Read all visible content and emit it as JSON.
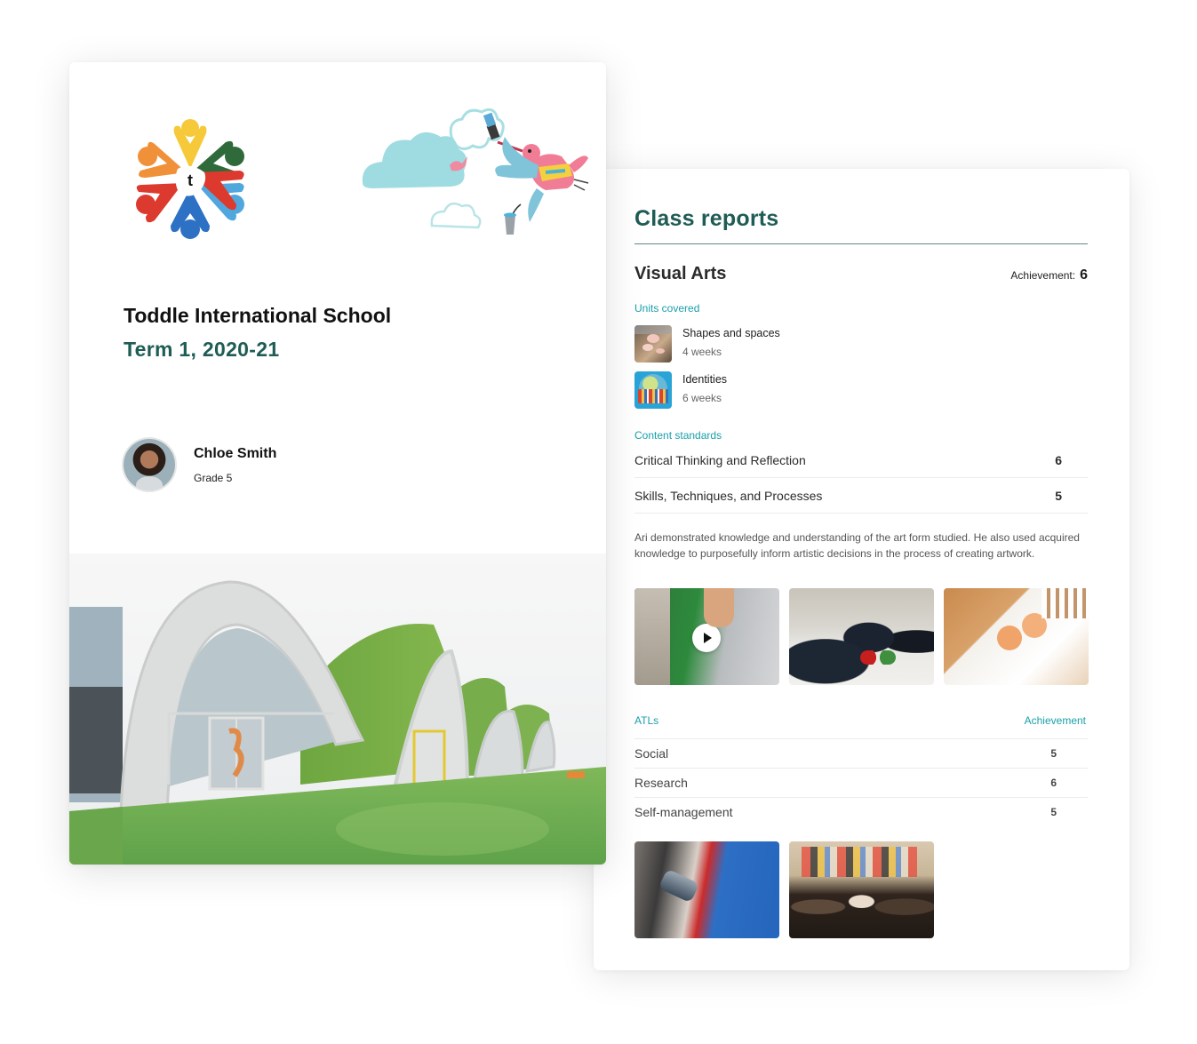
{
  "cover": {
    "school_name": "Toddle International School",
    "term": "Term 1, 2020-21",
    "logo_letter": "t",
    "student": {
      "name": "Chloe Smith",
      "grade": "Grade 5"
    }
  },
  "report": {
    "title": "Class reports",
    "subject": {
      "name": "Visual Arts",
      "achievement_label": "Achievement:",
      "achievement_value": "6"
    },
    "units_label": "Units covered",
    "units": [
      {
        "name": "Shapes and spaces",
        "duration": "4 weeks"
      },
      {
        "name": "Identities",
        "duration": "6 weeks"
      }
    ],
    "standards_label": "Content standards",
    "standards": [
      {
        "name": "Critical Thinking and Reflection",
        "value": "6"
      },
      {
        "name": "Skills, Techniques, and Processes",
        "value": "5"
      }
    ],
    "comment": "Ari demonstrated knowledge and understanding of the art form studied. He also used acquired knowledge to purposefully inform artistic decisions in the process of creating artwork.",
    "atl_label": "ATLs",
    "atl_achievement_label": "Achievement",
    "atls": [
      {
        "name": "Social",
        "value": "5"
      },
      {
        "name": "Research",
        "value": "6"
      },
      {
        "name": "Self-management",
        "value": "5"
      }
    ]
  },
  "colors": {
    "brand_green": "#1f5c55",
    "section_teal": "#1a9fab"
  }
}
